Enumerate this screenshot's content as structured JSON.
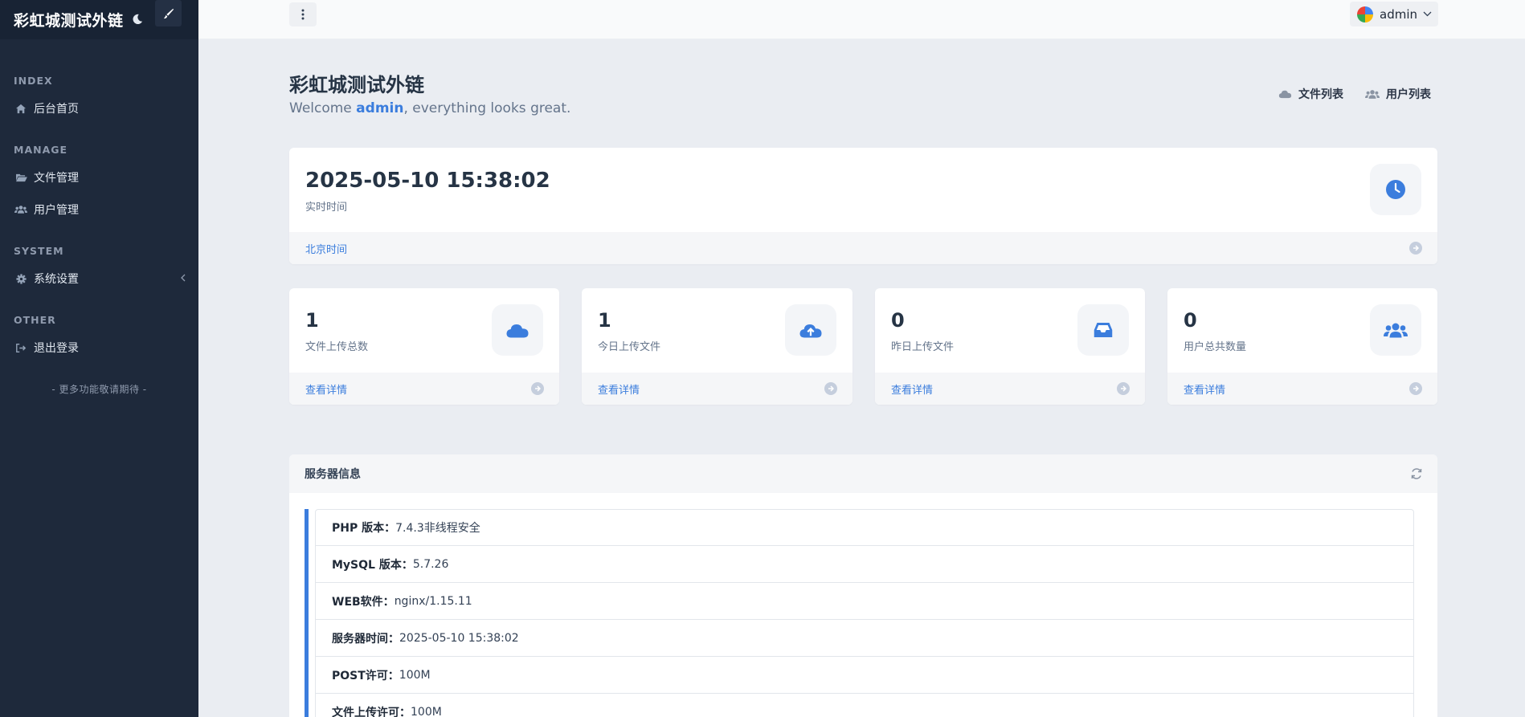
{
  "sidebar": {
    "title": "彩虹城测试外链",
    "sections": {
      "index": "INDEX",
      "manage": "MANAGE",
      "system": "SYSTEM",
      "other": "OTHER"
    },
    "items": {
      "home": "后台首页",
      "files": "文件管理",
      "users": "用户管理",
      "settings": "系统设置",
      "logout": "退出登录"
    },
    "more": "- 更多功能敬请期待 -"
  },
  "topbar": {
    "username": "admin"
  },
  "header": {
    "title": "彩虹城测试外链",
    "welcome_prefix": "Welcome ",
    "welcome_user": "admin",
    "welcome_suffix": ", everything looks great.",
    "link_files": "文件列表",
    "link_users": "用户列表"
  },
  "time_card": {
    "value": "2025-05-10 15:38:02",
    "label": "实时时间",
    "footer": "北京时间"
  },
  "stats": [
    {
      "value": "1",
      "label": "文件上传总数",
      "footer": "查看详情",
      "icon": "cloud-icon"
    },
    {
      "value": "1",
      "label": "今日上传文件",
      "footer": "查看详情",
      "icon": "cloud-upload-icon"
    },
    {
      "value": "0",
      "label": "昨日上传文件",
      "footer": "查看详情",
      "icon": "inbox-icon"
    },
    {
      "value": "0",
      "label": "用户总共数量",
      "footer": "查看详情",
      "icon": "users-icon"
    }
  ],
  "server": {
    "title": "服务器信息",
    "rows": [
      {
        "key": "PHP 版本：",
        "value": "7.4.3非线程安全"
      },
      {
        "key": "MySQL 版本：",
        "value": "5.7.26"
      },
      {
        "key": "WEB软件：",
        "value": "nginx/1.15.11"
      },
      {
        "key": "服务器时间：",
        "value": "2025-05-10 15:38:02"
      },
      {
        "key": "POST许可：",
        "value": "100M"
      },
      {
        "key": "文件上传许可：",
        "value": "100M"
      }
    ]
  },
  "colors": {
    "accent": "#3b7ddd",
    "sidebar": "#1e293b"
  }
}
